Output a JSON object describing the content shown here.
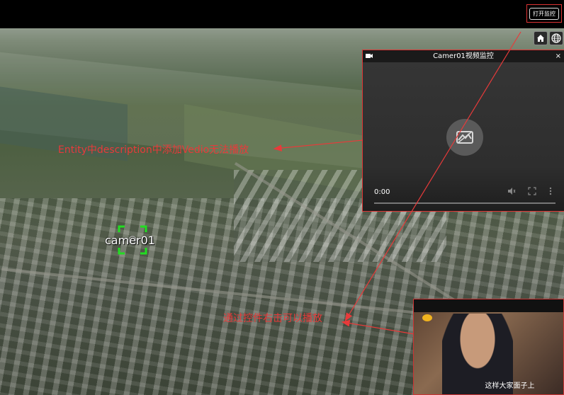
{
  "topbar": {
    "open_monitor_label": "打开监控"
  },
  "toolbar": {
    "home_icon": "home-icon",
    "globe_icon": "globe-icon"
  },
  "video_panel": {
    "title": "Camer01视频监控",
    "close_label": "×",
    "time": "0:00",
    "border_color": "#dd3333"
  },
  "map": {
    "entity_label": "camer01"
  },
  "annotations": {
    "description_note": "Entity中description中添加Vedio无法播放",
    "plugin_note": "通过控件右击可以播放",
    "color": "#e83a3a"
  },
  "thumbnail": {
    "subtitle": "这样大家面子上"
  }
}
